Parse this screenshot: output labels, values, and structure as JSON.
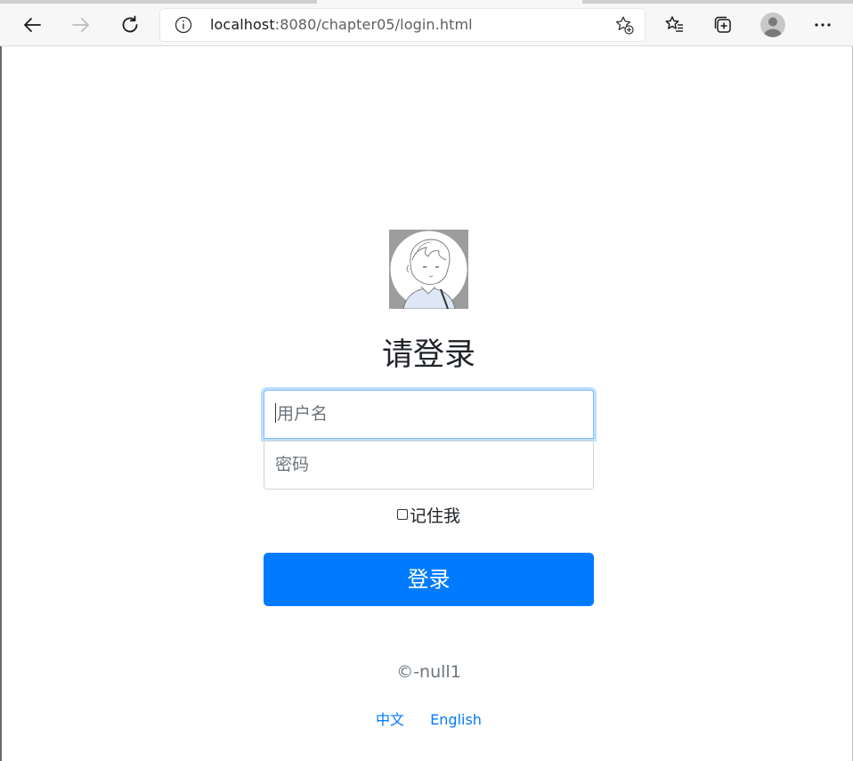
{
  "browser": {
    "url_host": "localhost",
    "url_path": ":8080/chapter05/login.html",
    "icons": {
      "back": "back-arrow-icon",
      "forward": "forward-arrow-icon",
      "refresh": "refresh-icon",
      "site_info": "info-icon",
      "add_favorite": "add-favorite-star-icon",
      "favorites": "favorites-icon",
      "collections": "collections-icon",
      "profile": "profile-avatar-icon",
      "menu": "more-menu-icon"
    }
  },
  "login": {
    "heading": "请登录",
    "username_placeholder": "用户名",
    "password_placeholder": "密码",
    "remember_label": "记住我",
    "submit_label": "登录",
    "copyright": "©-null1",
    "languages": [
      "中文",
      "English"
    ]
  },
  "colors": {
    "primary": "#007bff",
    "text": "#212529",
    "muted": "#6c757d",
    "focus_border": "#80bdff",
    "input_border": "#ced4da",
    "avatar_bg": "#9d9d9d"
  }
}
